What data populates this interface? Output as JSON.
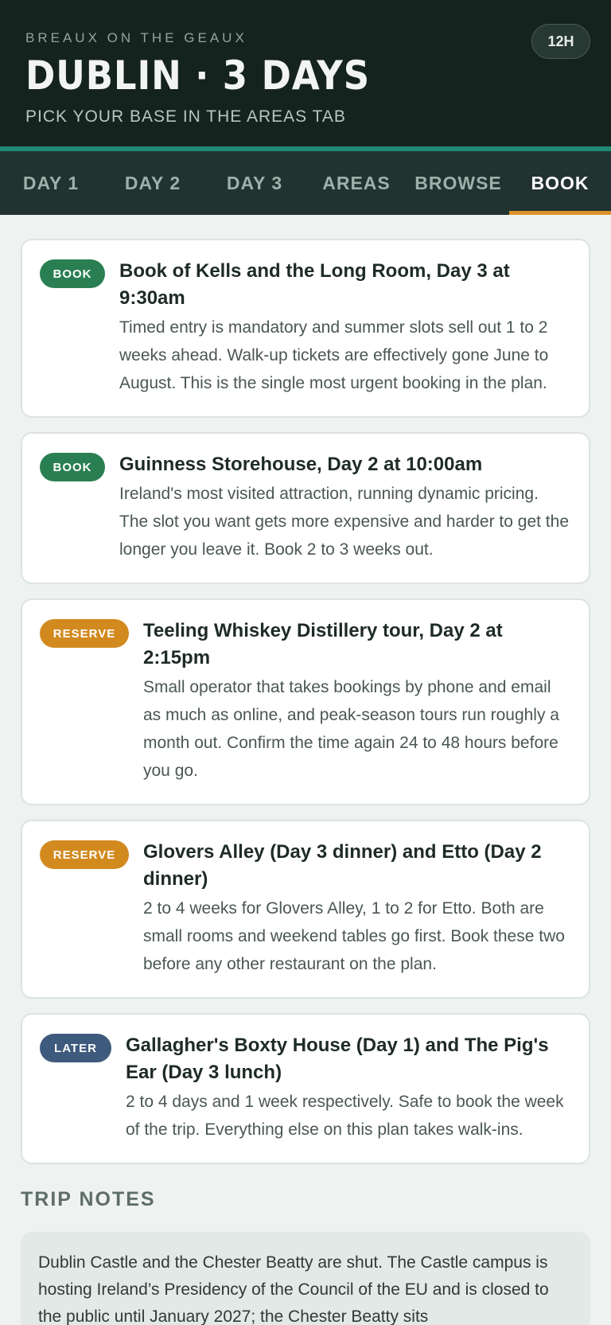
{
  "header": {
    "brand": "BREAUX ON THE GEAUX",
    "title": "DUBLIN · 3 DAYS",
    "subtitle": "PICK YOUR BASE IN THE AREAS TAB",
    "time_format": "12H"
  },
  "tabs": [
    {
      "label": "DAY 1",
      "active": false
    },
    {
      "label": "DAY 2",
      "active": false
    },
    {
      "label": "DAY 3",
      "active": false
    },
    {
      "label": "AREAS",
      "active": false
    },
    {
      "label": "BROWSE",
      "active": false
    },
    {
      "label": "BOOK",
      "active": true
    }
  ],
  "cards": [
    {
      "tag": "BOOK",
      "title": "Book of Kells and the Long Room, Day 3 at 9:30am",
      "text": "Timed entry is mandatory and summer slots sell out 1 to 2 weeks ahead. Walk-up tickets are effectively gone June to August. This is the single most urgent booking in the plan."
    },
    {
      "tag": "BOOK",
      "title": "Guinness Storehouse, Day 2 at 10:00am",
      "text": "Ireland's most visited attraction, running dynamic pricing. The slot you want gets more expensive and harder to get the longer you leave it. Book 2 to 3 weeks out."
    },
    {
      "tag": "RESERVE",
      "title": "Teeling Whiskey Distillery tour, Day 2 at 2:15pm",
      "text": "Small operator that takes bookings by phone and email as much as online, and peak-season tours run roughly a month out. Confirm the time again 24 to 48 hours before you go."
    },
    {
      "tag": "RESERVE",
      "title": "Glovers Alley (Day 3 dinner) and Etto (Day 2 dinner)",
      "text": "2 to 4 weeks for Glovers Alley, 1 to 2 for Etto. Both are small rooms and weekend tables go first. Book these two before any other restaurant on the plan."
    },
    {
      "tag": "LATER",
      "title": "Gallagher's Boxty House (Day 1) and The Pig's Ear (Day 3 lunch)",
      "text": "2 to 4 days and 1 week respectively. Safe to book the week of the trip. Everything else on this plan takes walk-ins."
    }
  ],
  "notes": {
    "title": "TRIP NOTES",
    "text": "Dublin Castle and the Chester Beatty are shut. The Castle campus is hosting Ireland’s Presidency of the Council of the EU and is closed to the public until January 2027; the Chester Beatty sits"
  },
  "colors": {
    "header_bg": "#15231f",
    "accent_teal": "#1f8a78",
    "active_tab_underline": "#d9932a",
    "book": "#2a7f52",
    "reserve": "#d28a1f",
    "later": "#3e5a7c"
  }
}
